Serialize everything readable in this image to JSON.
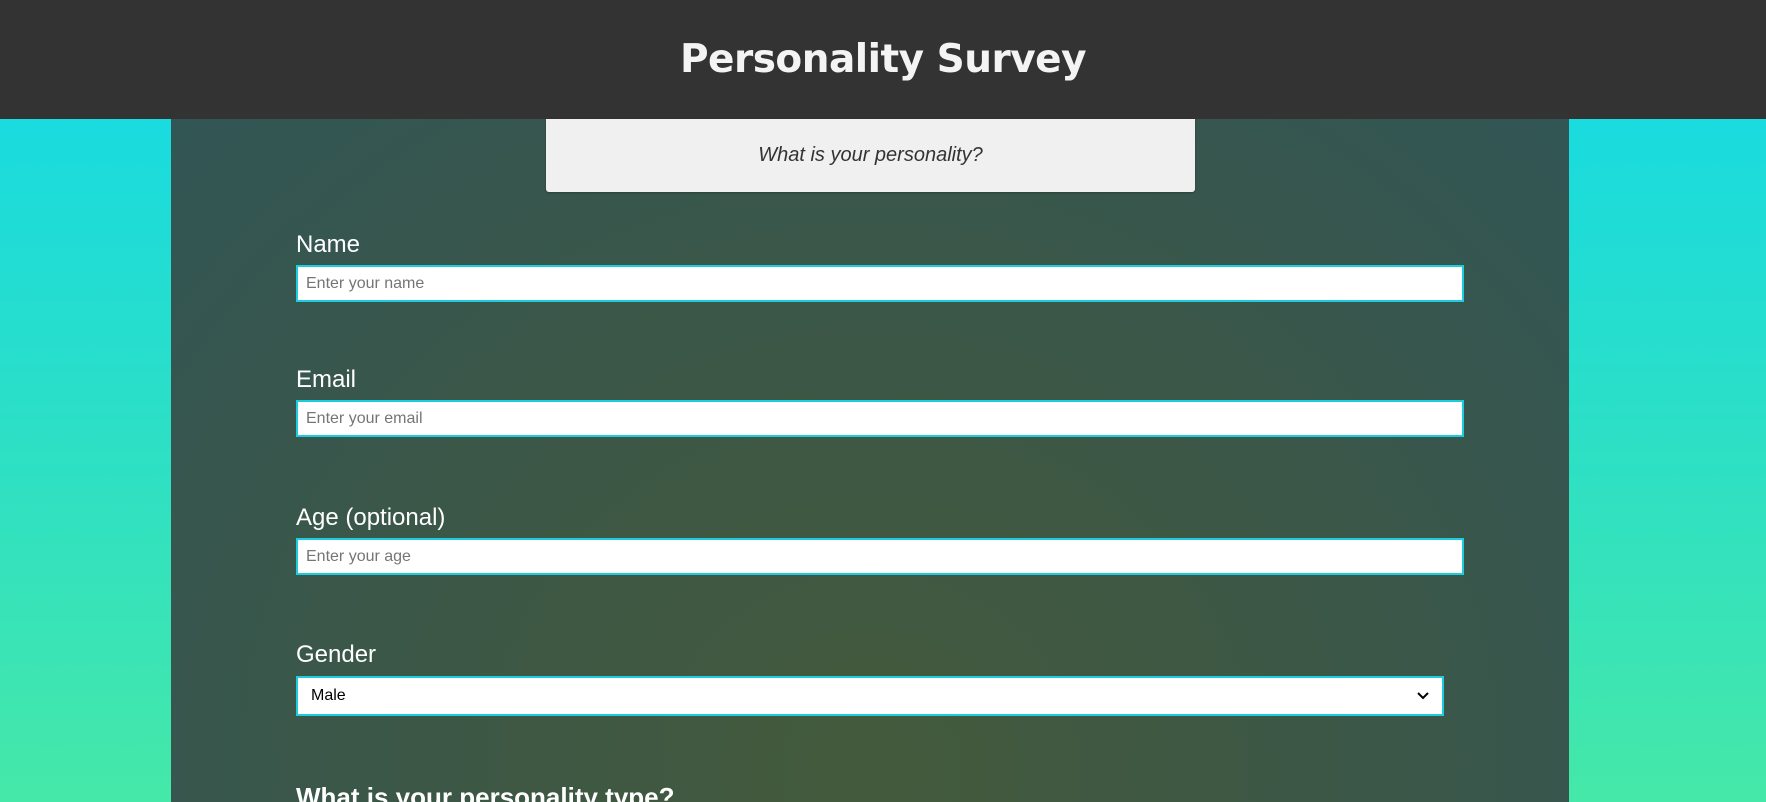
{
  "header": {
    "title": "Personality Survey"
  },
  "tagline": {
    "text": "What is your personality?"
  },
  "form": {
    "name": {
      "label": "Name",
      "placeholder": "Enter your name",
      "value": ""
    },
    "email": {
      "label": "Email",
      "placeholder": "Enter your email",
      "value": ""
    },
    "age": {
      "label": "Age (optional)",
      "placeholder": "Enter your age",
      "value": ""
    },
    "gender": {
      "label": "Gender",
      "selected": "Male"
    },
    "personality_heading": "What is your personality type?"
  },
  "colors": {
    "header_bg": "#333333",
    "panel_bg": "#3c5746",
    "input_border": "#1ccde0",
    "page_gradient_top": "#13d9e8",
    "page_gradient_bottom": "#45e8a8"
  }
}
